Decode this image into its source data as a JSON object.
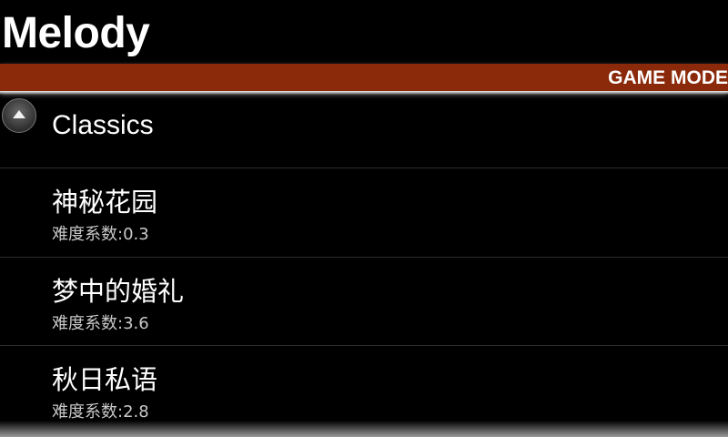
{
  "app": {
    "title": "Melody"
  },
  "mode_bar": {
    "label": "GAME MODE",
    "color": "#8b2a0b"
  },
  "list": {
    "section": {
      "label": "Classics",
      "icon": "chevron-up-circle-icon"
    },
    "items": [
      {
        "title": "神秘花园",
        "difficulty": "难度系数:0.3"
      },
      {
        "title": "梦中的婚礼",
        "difficulty": "难度系数:3.6"
      },
      {
        "title": "秋日私语",
        "difficulty": "难度系数:2.8"
      }
    ]
  }
}
